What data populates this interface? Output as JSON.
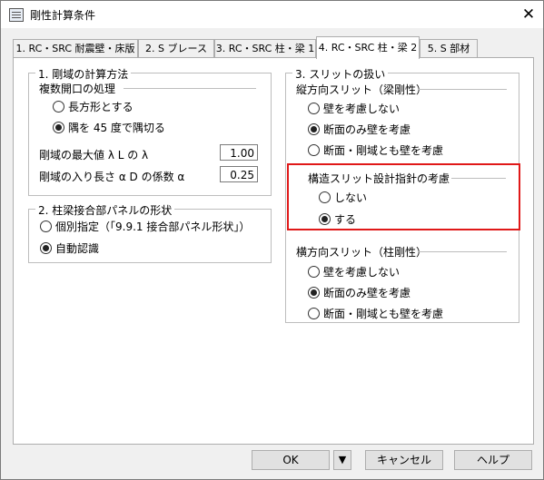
{
  "window": {
    "title": "剛性計算条件",
    "close": "✕"
  },
  "tabs": [
    {
      "label": "1. RC・SRC 耐震壁・床版"
    },
    {
      "label": "2. S ブレース"
    },
    {
      "label": "3. RC・SRC 柱・梁 1"
    },
    {
      "label": "4. RC・SRC 柱・梁 2"
    },
    {
      "label": "5. S 部材"
    }
  ],
  "rigid_zone": {
    "title": "1. 剛域の計算方法",
    "opening_subhead": "複数開口の処理",
    "opt_rect": "長方形とする",
    "opt_corner": "隅を 45 度で隅切る",
    "max_label": "剛域の最大値 λ L の λ",
    "max_value": "1.00",
    "coef_label": "剛域の入り長さ α D の係数 α",
    "coef_value": "0.25"
  },
  "panel": {
    "title": "2. 柱梁接合部パネルの形状",
    "opt_manual": "個別指定（「9.9.1 接合部パネル形状」）",
    "opt_auto": "自動認識"
  },
  "slit": {
    "title": "3. スリットの扱い",
    "vertical_subhead": "縦方向スリット（梁剛性）",
    "v_opt1": "壁を考慮しない",
    "v_opt2": "断面のみ壁を考慮",
    "v_opt3": "断面・剛域とも壁を考慮",
    "design_subhead": "構造スリット設計指針の考慮",
    "d_opt1": "しない",
    "d_opt2": "する",
    "horizontal_subhead": "横方向スリット（柱剛性）",
    "h_opt1": "壁を考慮しない",
    "h_opt2": "断面のみ壁を考慮",
    "h_opt3": "断面・剛域とも壁を考慮"
  },
  "buttons": {
    "ok": "OK",
    "dropdown": "▼",
    "cancel": "キャンセル",
    "help": "ヘルプ"
  },
  "colors": {
    "highlight": "#e01919"
  }
}
